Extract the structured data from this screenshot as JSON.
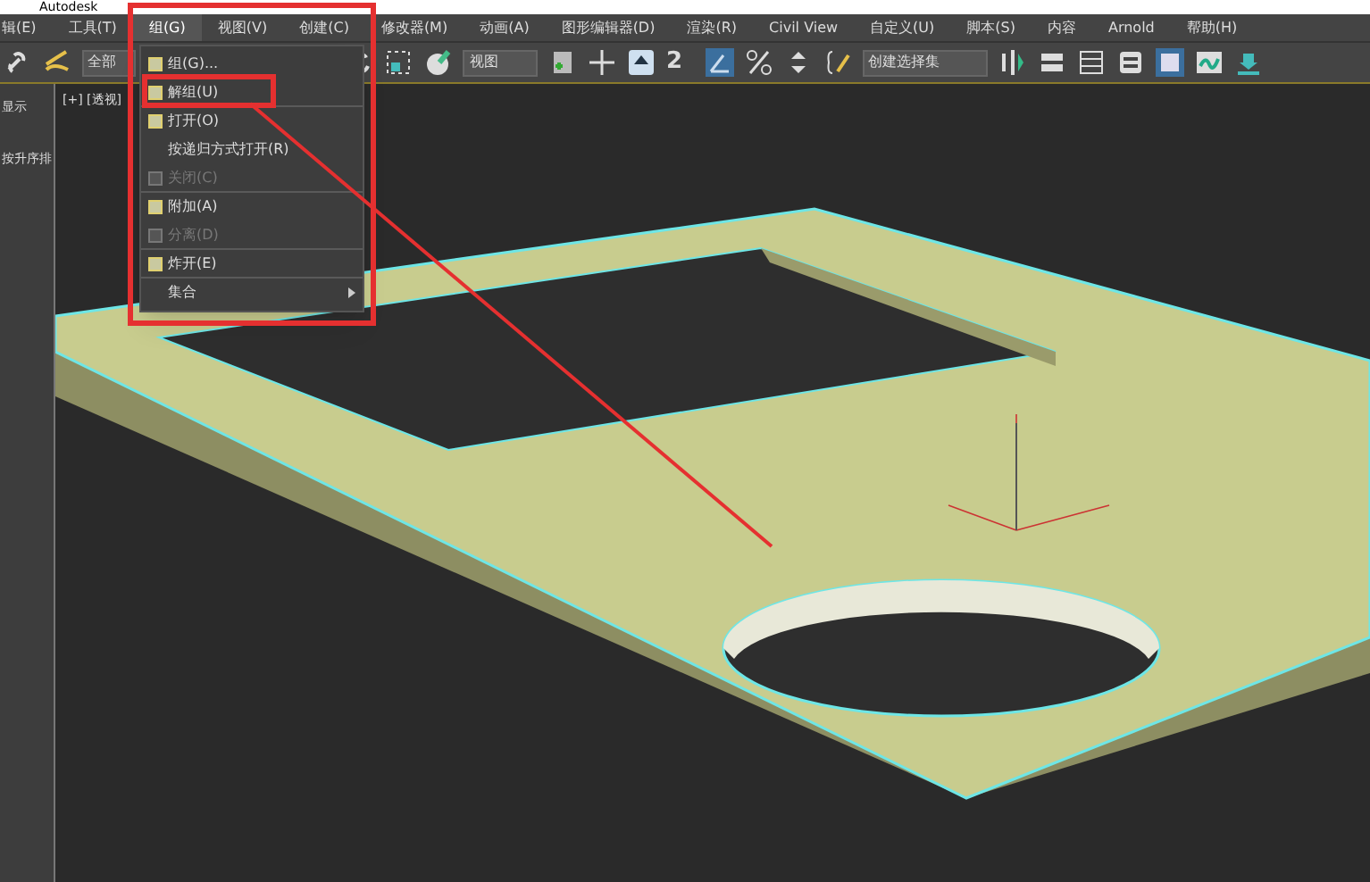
{
  "window": {
    "title": "Autodesk"
  },
  "menu_bar": [
    {
      "label": "辑(E)",
      "selected": false
    },
    {
      "label": "工具(T)",
      "selected": false
    },
    {
      "label": "组(G)",
      "selected": true
    },
    {
      "label": "视图(V)",
      "selected": false
    },
    {
      "label": "创建(C)",
      "selected": false
    },
    {
      "label": "修改器(M)",
      "selected": false
    },
    {
      "label": "动画(A)",
      "selected": false
    },
    {
      "label": "图形编辑器(D)",
      "selected": false
    },
    {
      "label": "渲染(R)",
      "selected": false
    },
    {
      "label": "Civil View",
      "selected": false
    },
    {
      "label": "自定义(U)",
      "selected": false
    },
    {
      "label": "脚本(S)",
      "selected": false
    },
    {
      "label": "内容",
      "selected": false
    },
    {
      "label": "Arnold",
      "selected": false
    },
    {
      "label": "帮助(H)",
      "selected": false
    }
  ],
  "toolbar": {
    "selection_filter": "全部",
    "coordinate_system": "视图",
    "named_selection": "创建选择集",
    "snap_label": "2"
  },
  "group_menu": [
    {
      "label": "组(G)...",
      "disabled": false,
      "icon": true,
      "submenu": false,
      "separator_after": false
    },
    {
      "label": "解组(U)",
      "disabled": false,
      "icon": true,
      "submenu": false,
      "separator_after": true
    },
    {
      "label": "打开(O)",
      "disabled": false,
      "icon": true,
      "submenu": false,
      "separator_after": false
    },
    {
      "label": "按递归方式打开(R)",
      "disabled": false,
      "icon": false,
      "submenu": false,
      "separator_after": false
    },
    {
      "label": "关闭(C)",
      "disabled": true,
      "icon": true,
      "submenu": false,
      "separator_after": true
    },
    {
      "label": "附加(A)",
      "disabled": false,
      "icon": true,
      "submenu": false,
      "separator_after": false
    },
    {
      "label": "分离(D)",
      "disabled": true,
      "icon": true,
      "submenu": false,
      "separator_after": true
    },
    {
      "label": "炸开(E)",
      "disabled": false,
      "icon": true,
      "submenu": false,
      "separator_after": true
    },
    {
      "label": "集合",
      "disabled": false,
      "icon": false,
      "submenu": true,
      "separator_after": false
    }
  ],
  "side_panel": [
    "显示",
    "按升序排"
  ],
  "viewport": {
    "label": "[+] [透视]"
  }
}
